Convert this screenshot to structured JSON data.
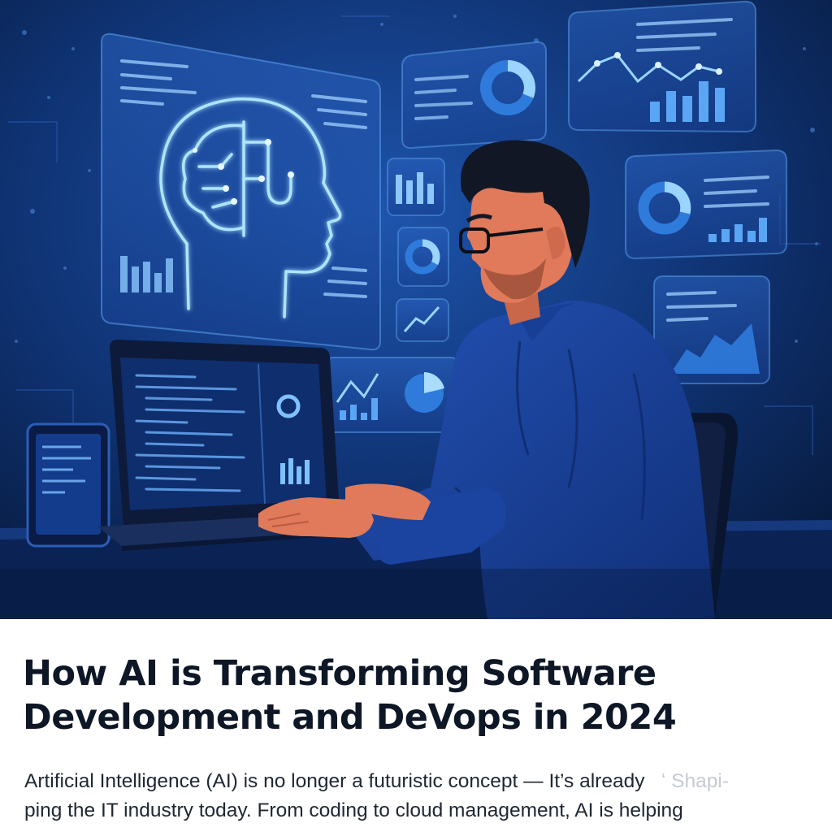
{
  "article": {
    "title_lines": [
      "How AI is Transforming Software",
      "Development and DeVops in 2024"
    ],
    "body_lines": [
      "Artificial Intelligence (AI) is no longer a futuristic concept — It’s already",
      "ping the IT industry today. From coding to cloud management, AI is helping"
    ],
    "body_faded_fragment": "ʻ Shapi-"
  },
  "hero": {
    "description_alt": "Illustration of a developer at a laptop with AI holographic dashboards",
    "colors": {
      "background_dark": "#071a45",
      "background_light": "#1b4a9a",
      "glow": "#8fd6ff",
      "panel": "#1a4aa5",
      "shirt": "#1c46a0",
      "skin": "#e07a5a",
      "hair": "#10141f"
    },
    "icons": [
      "brain-head-icon",
      "donut-chart-icon",
      "bar-chart-icon",
      "line-chart-icon",
      "pie-chart-icon"
    ]
  }
}
